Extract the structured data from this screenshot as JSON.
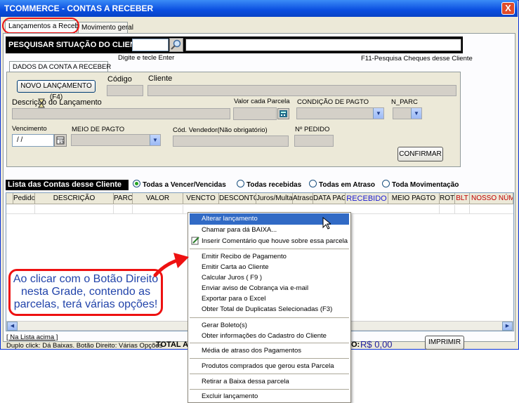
{
  "window": {
    "title": "TCOMMERCE - CONTAS A RECEBER",
    "close": "X"
  },
  "tabs": [
    {
      "label": "Lançamentos a Receber"
    },
    {
      "label": "Movimento geral"
    }
  ],
  "search": {
    "label": "PESQUISAR SITUAÇÃO DO CLIENTE:",
    "hint": "Digite e tecle Enter",
    "f11_hint": "F11-Pesquisa Cheques desse Cliente"
  },
  "account": {
    "tab_label": "DADOS DA CONTA A RECEBER",
    "new_button": "NOVO LANÇAMENTO (F4)",
    "codigo_label": "Código",
    "cliente_label": "Cliente",
    "descricao_label": "Descrição do Lançamento",
    "valor_parcela_label": "Valor cada Parcela",
    "condicao_label": "CONDIÇÃO DE PAGTO",
    "nparc_label": "N_PARC",
    "vencimento_label": "Vencimento",
    "vencimento_value": " / /",
    "meio_label": "MEIO DE PAGTO",
    "vendedor_label": "Cód. Vendedor(Não obrigatório)",
    "pedido_label": "Nº PEDIDO",
    "confirm_button": "CONFIRMAR"
  },
  "list": {
    "title": "Lista das Contas desse Cliente",
    "filters": [
      {
        "label": "Todas a Vencer/Vencidas",
        "selected": true
      },
      {
        "label": "Todas recebidas",
        "selected": false
      },
      {
        "label": "Todas em Atraso",
        "selected": false
      },
      {
        "label": "Toda Movimentação",
        "selected": false
      }
    ],
    "columns": [
      "Pedido",
      "DESCRIÇÃO",
      "PARC",
      "VALOR",
      "VENCTO",
      "DESCONTO",
      "Juros/Multa",
      "Atraso",
      "DATA PAG",
      "RECEBIDO",
      "MEIO PAGTO",
      "ROT",
      "BLT",
      "NOSSO NÚME"
    ],
    "column_colors": {
      "RECEBIDO": "#1b1bd1",
      "BLT": "#c00000",
      "NOSSO NÚME": "#c00000"
    }
  },
  "footer": {
    "na_lista": "[ Na Lista acima ]",
    "help": "Duplo click: Dá Baixas. Botão Direito: Várias Opções",
    "total_label": "TOTAL A",
    "received_suffix": "O:",
    "received_value": "R$ 0,00",
    "print_button": "IMPRIMIR"
  },
  "context_menu": {
    "groups": [
      [
        "Alterar lançamento",
        "Chamar para dá BAIXA...",
        "Inserir Comentário que houve sobre essa parcela"
      ],
      [
        "Emitir Recibo de Pagamento",
        "Emitir Carta ao Cliente",
        "Calcular Juros ( F9 )",
        "Enviar aviso de Cobrança via e-mail",
        "Exportar para o Excel",
        "Obter Total de Duplicatas Selecionadas (F3)"
      ],
      [
        "Gerar Boleto(s)",
        "Obter informações do Cadastro do Cliente"
      ],
      [
        "Média de atraso dos Pagamentos"
      ],
      [
        "Produtos comprados que gerou esta Parcela"
      ],
      [
        "Retirar a Baixa dessa parcela"
      ],
      [
        "Excluir lançamento"
      ]
    ],
    "highlighted": "Alterar lançamento"
  },
  "callout": {
    "text": "Ao clicar com o Botão Direito nesta Grade, contendo as parcelas, terá várias opções!"
  },
  "colors": {
    "title_blue": "#0a4ee0",
    "highlight": "#316ac5",
    "callout_red": "#e11111",
    "callout_text": "#2244aa"
  }
}
